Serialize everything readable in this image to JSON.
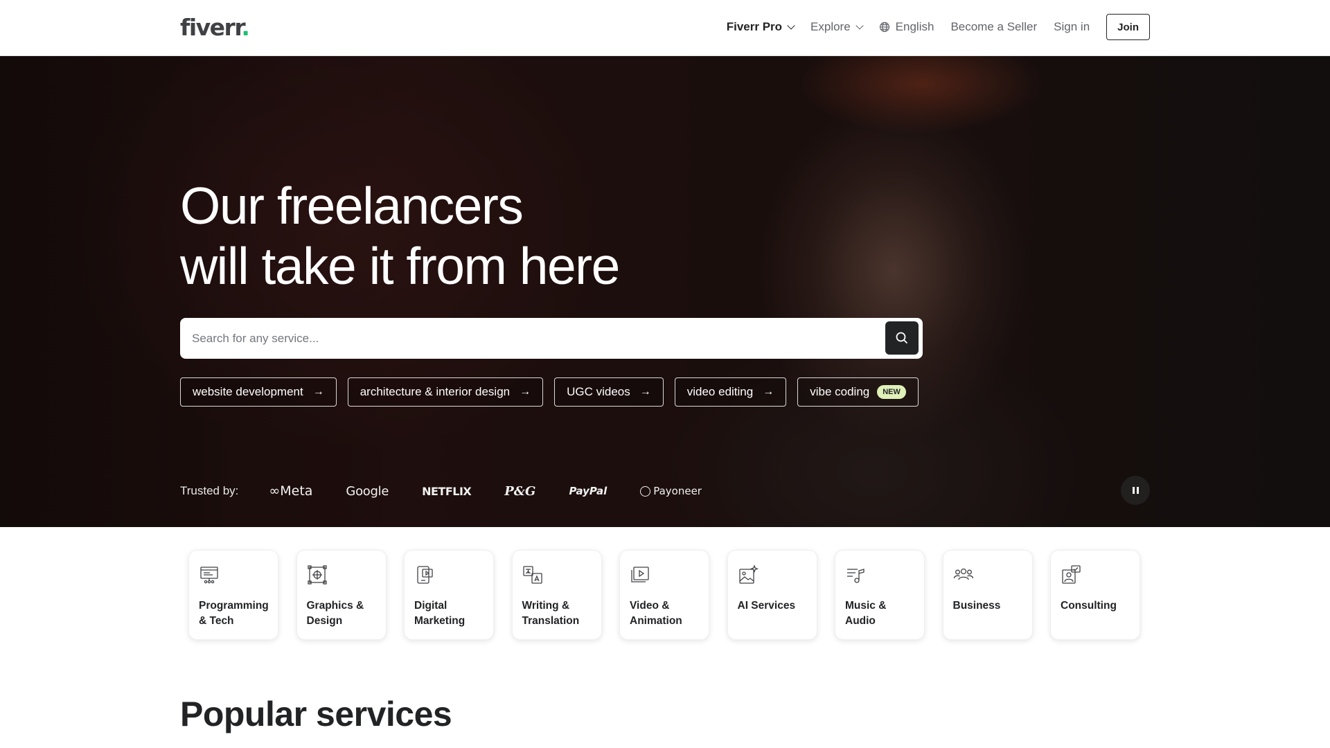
{
  "header": {
    "logo_text": "fiverr",
    "logo_dot": ".",
    "nav": {
      "fiverr_pro": "Fiverr Pro",
      "explore": "Explore",
      "language": "English",
      "become_seller": "Become a Seller",
      "sign_in": "Sign in",
      "join": "Join"
    }
  },
  "hero": {
    "title_line1": "Our freelancers",
    "title_line2": "will take it from here",
    "search": {
      "placeholder": "Search for any service..."
    },
    "chips": [
      {
        "label": "website development",
        "arrow": "→"
      },
      {
        "label": "architecture & interior design",
        "arrow": "→"
      },
      {
        "label": "UGC videos",
        "arrow": "→"
      },
      {
        "label": "video editing",
        "arrow": "→"
      },
      {
        "label": "vibe coding",
        "badge": "NEW"
      }
    ],
    "trusted": {
      "label": "Trusted by:",
      "brands": [
        "Meta",
        "Google",
        "NETFLIX",
        "P&G",
        "PayPal",
        "Payoneer"
      ]
    }
  },
  "categories": [
    {
      "label_line1": "Programming",
      "label_line2": "& Tech",
      "icon": "monitor-code-icon"
    },
    {
      "label_line1": "Graphics &",
      "label_line2": "Design",
      "icon": "design-frame-icon"
    },
    {
      "label_line1": "Digital",
      "label_line2": "Marketing",
      "icon": "marketing-screen-icon"
    },
    {
      "label_line1": "Writing &",
      "label_line2": "Translation",
      "icon": "translation-icon"
    },
    {
      "label_line1": "Video &",
      "label_line2": "Animation",
      "icon": "video-play-icon"
    },
    {
      "label_line1": "AI Services",
      "label_line2": "",
      "icon": "ai-sparkle-image-icon"
    },
    {
      "label_line1": "Music & Audio",
      "label_line2": "",
      "icon": "music-note-icon"
    },
    {
      "label_line1": "Business",
      "label_line2": "",
      "icon": "people-group-icon"
    },
    {
      "label_line1": "Consulting",
      "label_line2": "",
      "icon": "consulting-chat-icon"
    }
  ],
  "section": {
    "popular_title": "Popular services"
  },
  "colors": {
    "brand_green": "#1dbf73",
    "text_dark": "#222325",
    "new_badge": "#dff0b8"
  }
}
